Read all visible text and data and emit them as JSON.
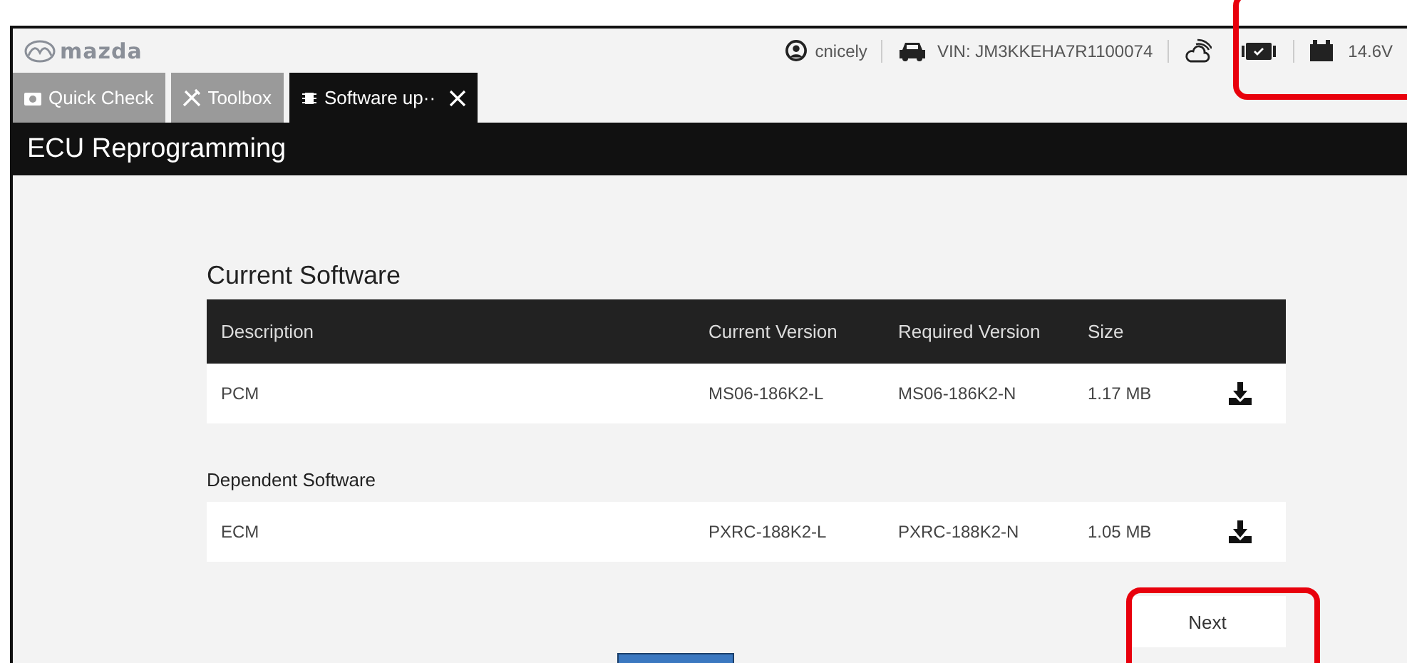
{
  "header": {
    "logo": "mazda",
    "user": "cnicely",
    "vin": "VIN: JM3KKEHA7R1100074",
    "voltage": "14.6V"
  },
  "tabs": [
    {
      "label": "Quick Check",
      "kind": "camera",
      "selected": false
    },
    {
      "label": "Toolbox",
      "kind": "tools",
      "selected": false
    },
    {
      "label": "Software up··",
      "kind": "chip",
      "selected": true,
      "closable": true
    }
  ],
  "title": "ECU Reprogramming",
  "sections": [
    {
      "heading": "Current Software",
      "columns": [
        "Description",
        "Current Version",
        "Required Version",
        "Size"
      ],
      "rows": [
        {
          "description": "PCM",
          "current": "MS06-186K2-L",
          "required": "MS06-186K2-N",
          "size": "1.17 MB"
        }
      ]
    },
    {
      "heading": "Dependent Software",
      "rows": [
        {
          "description": "ECM",
          "current": "PXRC-188K2-L",
          "required": "PXRC-188K2-N",
          "size": "1.05 MB"
        }
      ]
    }
  ],
  "next_button": "Next"
}
